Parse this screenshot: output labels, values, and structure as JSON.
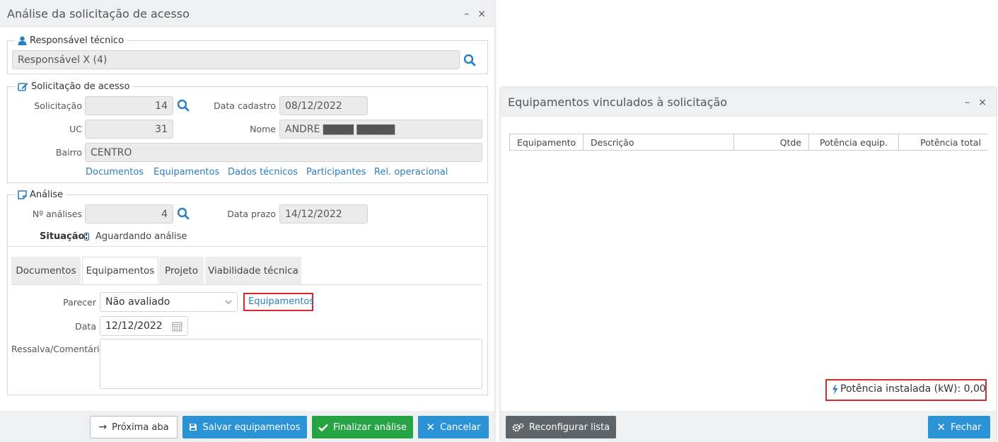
{
  "left_dialog": {
    "title": "Análise da solicitação de acesso",
    "minimize": "–",
    "close": "×",
    "responsavel": {
      "legend": "Responsável técnico",
      "value": "Responsável X (4)"
    },
    "solicitacao": {
      "legend": "Solicitação de acesso",
      "solicitacao_label": "Solicitação",
      "solicitacao_value": "14",
      "data_cadastro_label": "Data cadastro",
      "data_cadastro_value": "08/12/2022",
      "uc_label": "UC",
      "uc_value": "31",
      "nome_label": "Nome",
      "nome_value": "ANDRE ▇▇▇▇ ▇▇▇▇▇",
      "bairro_label": "Bairro",
      "bairro_value": "CENTRO",
      "links": [
        "Documentos",
        "Equipamentos",
        "Dados técnicos",
        "Participantes",
        "Rel. operacional"
      ]
    },
    "analise": {
      "legend": "Análise",
      "num_analises_label": "Nº análises",
      "num_analises_value": "4",
      "data_prazo_label": "Data prazo",
      "data_prazo_value": "14/12/2022",
      "situacao_label": "Situação:",
      "situacao_value": "Aguardando análise"
    },
    "tabs": [
      "Documentos",
      "Equipamentos",
      "Projeto",
      "Viabilidade técnica"
    ],
    "active_tab": "Equipamentos",
    "parecer_label": "Parecer",
    "parecer_value": "Não avaliado",
    "equipamentos_link": "Equipamentos",
    "data_label": "Data",
    "data_value": "12/12/2022",
    "ressalva_label": "Ressalva/Comentário",
    "ressalva_value": "",
    "buttons": {
      "proxima_aba": "Próxima aba",
      "salvar": "Salvar equipamentos",
      "finalizar": "Finalizar análise",
      "cancelar": "Cancelar"
    }
  },
  "right_dialog": {
    "title": "Equipamentos vinculados à solicitação",
    "minimize": "–",
    "close": "×",
    "columns": [
      "Equipamento",
      "Descrição",
      "Qtde",
      "Potência equip.",
      "Potência total"
    ],
    "rows": [],
    "potencia_label": "Potência instalada (kW): 0,00",
    "buttons": {
      "reconfigurar": "Reconfigurar lista",
      "fechar": "Fechar"
    }
  },
  "colors": {
    "accent_blue": "#2a93d5",
    "accent_green": "#25a244",
    "link_blue": "#2a7fc0",
    "highlight_red": "#d42a2a"
  }
}
